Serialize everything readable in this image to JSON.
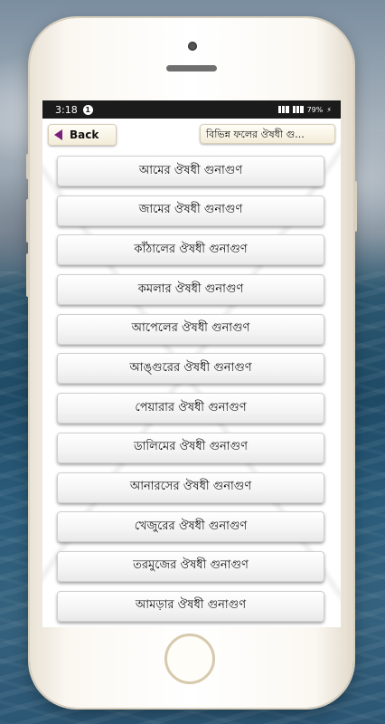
{
  "status_bar": {
    "time": "3:18",
    "notification_count": "1",
    "battery": "79%"
  },
  "toolbar": {
    "back_label": "Back",
    "title": "বিভিন্ন ফলের ঔষধী গু..."
  },
  "items": [
    {
      "label": "আমের ঔষধী গুনাগুণ"
    },
    {
      "label": "জামের ঔষধী গুনাগুণ"
    },
    {
      "label": "কাঁঠালের ঔষধী গুনাগুণ"
    },
    {
      "label": "কমলার ঔষধী গুনাগুণ"
    },
    {
      "label": "আপেলের ঔষধী গুনাগুণ"
    },
    {
      "label": "আঙ্গুরের ঔষধী গুনাগুণ"
    },
    {
      "label": "পেয়ারার ঔষধী গুনাগুণ"
    },
    {
      "label": "ডালিমের ঔষধী গুনাগুণ"
    },
    {
      "label": "আনারসের ঔষধী গুনাগুণ"
    },
    {
      "label": "খেজুরের ঔষধী গুনাগুণ"
    },
    {
      "label": "তরমুজের ঔষধী গুনাগুণ"
    },
    {
      "label": "আমড়ার ঔষধী গুনাগুণ"
    }
  ],
  "icons": {
    "back": "back-arrow-icon",
    "signal": "signal-icon",
    "battery": "battery-icon"
  },
  "colors": {
    "back_arrow": "#7a1f7a",
    "status_bar": "#1b1b1b",
    "item_bg": "#f4f4f4"
  }
}
